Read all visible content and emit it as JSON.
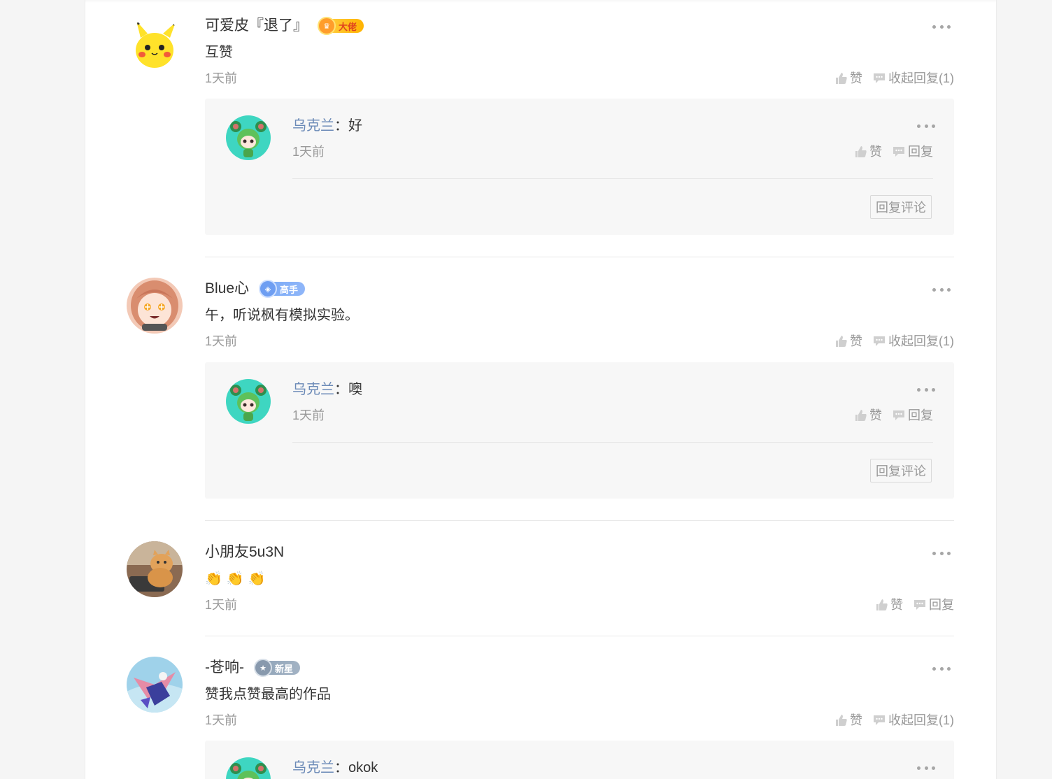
{
  "comments": [
    {
      "username": "可爱皮『退了』",
      "badge": {
        "label": "大佬",
        "icon": "crown-icon"
      },
      "content": "互赞",
      "time": "1天前",
      "like_label": "赞",
      "reply_label": "收起回复(1)",
      "replies": [
        {
          "username": "乌克兰",
          "separator": "：",
          "content": "好",
          "time": "1天前",
          "like_label": "赞",
          "reply_label": "回复"
        }
      ],
      "reply_comment_button": "回复评论"
    },
    {
      "username": "Blue心",
      "badge": {
        "label": "高手",
        "icon": "shield-icon"
      },
      "content": "午，听说枫有模拟实验。",
      "time": "1天前",
      "like_label": "赞",
      "reply_label": "收起回复(1)",
      "replies": [
        {
          "username": "乌克兰",
          "separator": "：",
          "content": "噢",
          "time": "1天前",
          "like_label": "赞",
          "reply_label": "回复"
        }
      ],
      "reply_comment_button": "回复评论"
    },
    {
      "username": "小朋友5u3N",
      "content_emojis": [
        "👏",
        "👏",
        "👏"
      ],
      "time": "1天前",
      "like_label": "赞",
      "reply_label": "回复"
    },
    {
      "username": "-苍响-",
      "badge": {
        "label": "新星",
        "icon": "star-icon"
      },
      "content": "赞我点赞最高的作品",
      "time": "1天前",
      "like_label": "赞",
      "reply_label": "收起回复(1)",
      "replies": [
        {
          "username": "乌克兰",
          "separator": "：",
          "content": "okok"
        }
      ]
    }
  ],
  "colors": {
    "page_bg": "#f5f5f5",
    "card_bg": "#ffffff",
    "reply_bg": "#f7f7f7",
    "reply_username": "#6b8ab7",
    "muted_text": "#999999",
    "badge_gold": "#ffc21a",
    "badge_blue": "#7faaf6",
    "badge_grey": "#97a9bc"
  }
}
